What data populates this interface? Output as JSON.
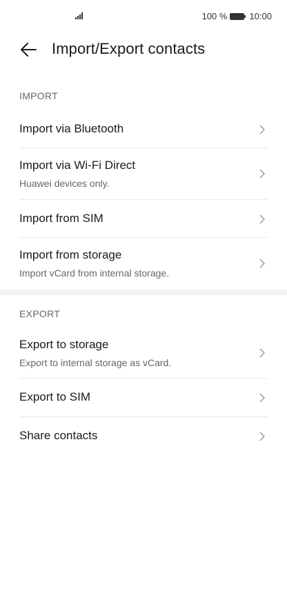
{
  "status": {
    "battery": "100 %",
    "time": "10:00"
  },
  "header": {
    "title": "Import/Export contacts"
  },
  "import_section": {
    "label": "IMPORT",
    "items": [
      {
        "title": "Import via Bluetooth",
        "subtitle": ""
      },
      {
        "title": "Import via Wi-Fi Direct",
        "subtitle": "Huawei devices only."
      },
      {
        "title": "Import from SIM",
        "subtitle": ""
      },
      {
        "title": "Import from storage",
        "subtitle": "Import vCard from internal storage."
      }
    ]
  },
  "export_section": {
    "label": "EXPORT",
    "items": [
      {
        "title": "Export to storage",
        "subtitle": "Export to internal storage as vCard."
      },
      {
        "title": "Export to SIM",
        "subtitle": ""
      },
      {
        "title": "Share contacts",
        "subtitle": ""
      }
    ]
  },
  "icons": {
    "back": "back-arrow-icon",
    "chevron": "chevron-right-icon",
    "signal": "signal-icon",
    "battery": "battery-icon"
  }
}
